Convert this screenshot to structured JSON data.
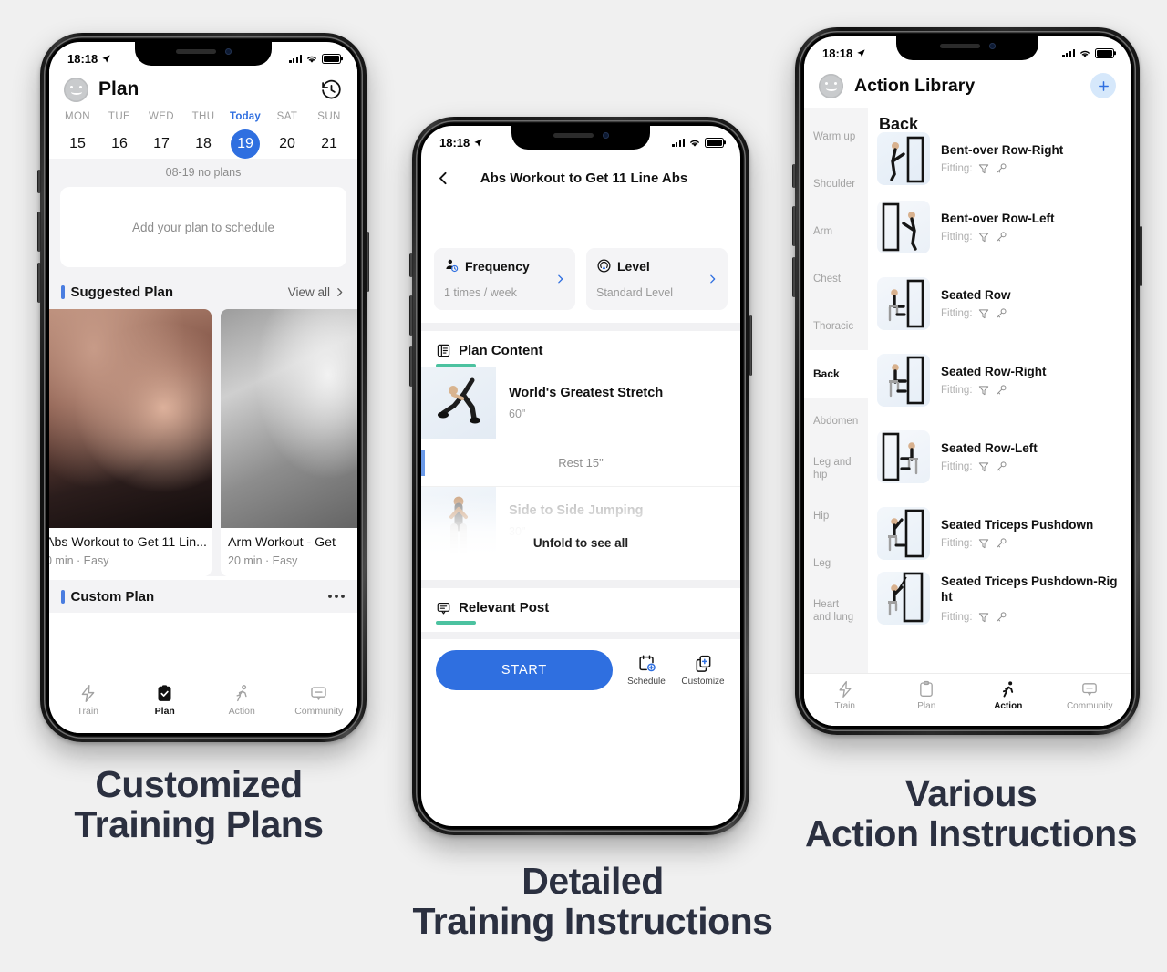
{
  "canvas": {
    "background": "#f0f0f0"
  },
  "theme": {
    "accent_blue": "#2f6fe0",
    "accent_teal": "#4cc2a0",
    "text_dark": "#2b3040",
    "muted": "#9a9a9a"
  },
  "phones": [
    {
      "id": "plan",
      "status": {
        "time": "18:18"
      },
      "appbar": {
        "title": "Plan",
        "avatar": "avatar-icon",
        "right_icon": "history-clock-icon"
      },
      "calendar": {
        "days": [
          {
            "label": "MON",
            "num": "15",
            "today": false
          },
          {
            "label": "TUE",
            "num": "16",
            "today": false
          },
          {
            "label": "WED",
            "num": "17",
            "today": false
          },
          {
            "label": "THU",
            "num": "18",
            "today": false
          },
          {
            "label": "Today",
            "num": "19",
            "today": true
          },
          {
            "label": "SAT",
            "num": "20",
            "today": false
          },
          {
            "label": "SUN",
            "num": "21",
            "today": false
          }
        ],
        "note": "08-19 no plans"
      },
      "empty_card": {
        "text": "Add your plan to schedule"
      },
      "suggested": {
        "title": "Suggested Plan",
        "view_all": "View all",
        "chevron": "chevron-right-icon",
        "cards": [
          {
            "title": "Abs Workout to Get 11 Lin...",
            "meta": "0 min · Easy"
          },
          {
            "title": "Arm Workout - Get",
            "meta": "20 min · Easy"
          }
        ]
      },
      "custom": {
        "title": "Custom Plan",
        "more": "more-dots-icon"
      },
      "tabs": [
        {
          "label": "Train",
          "icon": "lightning-icon",
          "active": false
        },
        {
          "label": "Plan",
          "icon": "clipboard-check-icon",
          "active": true
        },
        {
          "label": "Action",
          "icon": "running-person-icon",
          "active": false
        },
        {
          "label": "Community",
          "icon": "chat-bubble-icon",
          "active": false
        }
      ]
    },
    {
      "id": "detail",
      "status": {
        "time": "18:18"
      },
      "navbar": {
        "back": "chevron-left-icon",
        "title": "Abs Workout to Get 11 Line Abs"
      },
      "info_cards": [
        {
          "label": "Frequency",
          "value": "1 times / week",
          "icon": "person-clock-icon",
          "chevron": "chevron-right-icon"
        },
        {
          "label": "Level",
          "value": "Standard Level",
          "icon": "level-gauge-icon",
          "chevron": "chevron-right-icon"
        }
      ],
      "plan_content": {
        "title": "Plan Content",
        "icon": "list-doc-icon",
        "items": [
          {
            "name": "World's Greatest Stretch",
            "duration": "60\"",
            "type": "exercise"
          },
          {
            "name": "Rest 15\"",
            "type": "rest"
          },
          {
            "name": "Side to Side Jumping",
            "duration": "30\"",
            "type": "exercise-faded"
          }
        ],
        "unfold": "Unfold to see all"
      },
      "relevant_post": {
        "title": "Relevant Post",
        "icon": "comment-icon"
      },
      "actions": {
        "start": "START",
        "schedule": {
          "label": "Schedule",
          "icon": "calendar-plus-icon"
        },
        "customize": {
          "label": "Customize",
          "icon": "copy-plus-icon"
        }
      }
    },
    {
      "id": "library",
      "status": {
        "time": "18:18"
      },
      "appbar": {
        "title": "Action Library",
        "avatar": "avatar-icon",
        "add": "plus-icon"
      },
      "categories": [
        {
          "label": "Warm up",
          "active": false
        },
        {
          "label": "Shoulder",
          "active": false
        },
        {
          "label": "Arm",
          "active": false
        },
        {
          "label": "Chest",
          "active": false
        },
        {
          "label": "Thoracic",
          "active": false
        },
        {
          "label": "Back",
          "active": true
        },
        {
          "label": "Abdomen",
          "active": false
        },
        {
          "label": "Leg and hip",
          "active": false
        },
        {
          "label": "Hip",
          "active": false
        },
        {
          "label": "Leg",
          "active": false
        },
        {
          "label": "Heart and lung",
          "active": false
        }
      ],
      "group_title": "Back",
      "fitting_label": "Fitting:",
      "fitting_icons": [
        "funnel-icon",
        "key-icon"
      ],
      "exercises": [
        {
          "name": "Bent-over Row-Right"
        },
        {
          "name": "Bent-over Row-Left"
        },
        {
          "name": "Seated Row"
        },
        {
          "name": "Seated Row-Right"
        },
        {
          "name": "Seated Row-Left"
        },
        {
          "name": "Seated Triceps Pushdown"
        },
        {
          "name": "Seated Triceps Pushdown-Right"
        }
      ],
      "tabs": [
        {
          "label": "Train",
          "icon": "lightning-icon",
          "active": false
        },
        {
          "label": "Plan",
          "icon": "clipboard-icon",
          "active": false
        },
        {
          "label": "Action",
          "icon": "running-person-icon",
          "active": true
        },
        {
          "label": "Community",
          "icon": "chat-bubble-icon",
          "active": false
        }
      ]
    }
  ],
  "captions": [
    {
      "line1": "Customized",
      "line2": "Training Plans"
    },
    {
      "line1": "Detailed",
      "line2": "Training Instructions"
    },
    {
      "line1": "Various",
      "line2": "Action Instructions"
    }
  ]
}
